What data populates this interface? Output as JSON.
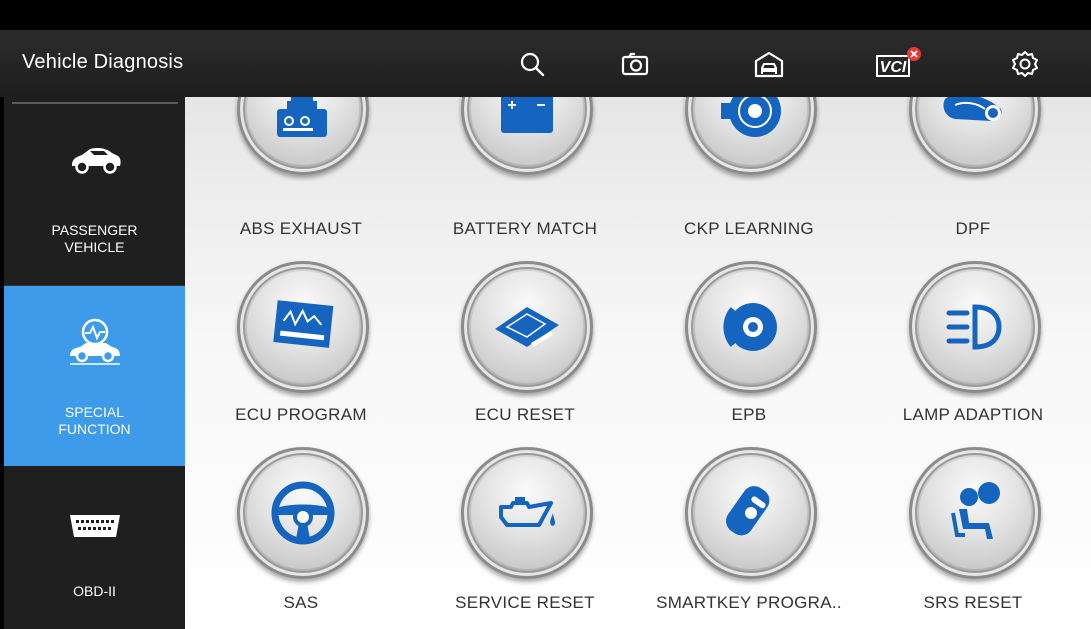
{
  "header": {
    "title": "Vehicle Diagnosis",
    "icons": [
      "search-icon",
      "camera-icon",
      "garage-icon",
      "vci-icon",
      "settings-icon"
    ],
    "vci_label": "VCI"
  },
  "sidebar": {
    "items": [
      {
        "label": "PASSENGER\nVEHICLE",
        "icon": "car-icon",
        "active": false
      },
      {
        "label": "SPECIAL\nFUNCTION",
        "icon": "diagnostic-car-icon",
        "active": true
      },
      {
        "label": "OBD-II",
        "icon": "obd-connector-icon",
        "active": false
      }
    ]
  },
  "functions": {
    "items": [
      {
        "label": "ABS EXHAUST",
        "icon": "abs-module-icon"
      },
      {
        "label": "BATTERY MATCH",
        "icon": "battery-icon"
      },
      {
        "label": "CKP LEARNING",
        "icon": "crankshaft-sensor-icon"
      },
      {
        "label": "DPF",
        "icon": "dpf-filter-icon"
      },
      {
        "label": "ECU PROGRAM",
        "icon": "ecu-program-icon"
      },
      {
        "label": "ECU RESET",
        "icon": "ecu-module-icon"
      },
      {
        "label": "EPB",
        "icon": "brake-disc-icon"
      },
      {
        "label": "LAMP ADAPTION",
        "icon": "headlamp-icon"
      },
      {
        "label": "SAS",
        "icon": "steering-wheel-icon"
      },
      {
        "label": "SERVICE RESET",
        "icon": "oil-can-icon"
      },
      {
        "label": "SMARTKEY PROGRA..",
        "icon": "smart-key-icon"
      },
      {
        "label": "SRS RESET",
        "icon": "airbag-seat-icon"
      }
    ]
  },
  "colors": {
    "accent": "#3d9be9",
    "icon_blue": "#1565c0",
    "header_bg": "#262626",
    "sidebar_bg": "#1f1f1f",
    "error_badge": "#e53935"
  }
}
